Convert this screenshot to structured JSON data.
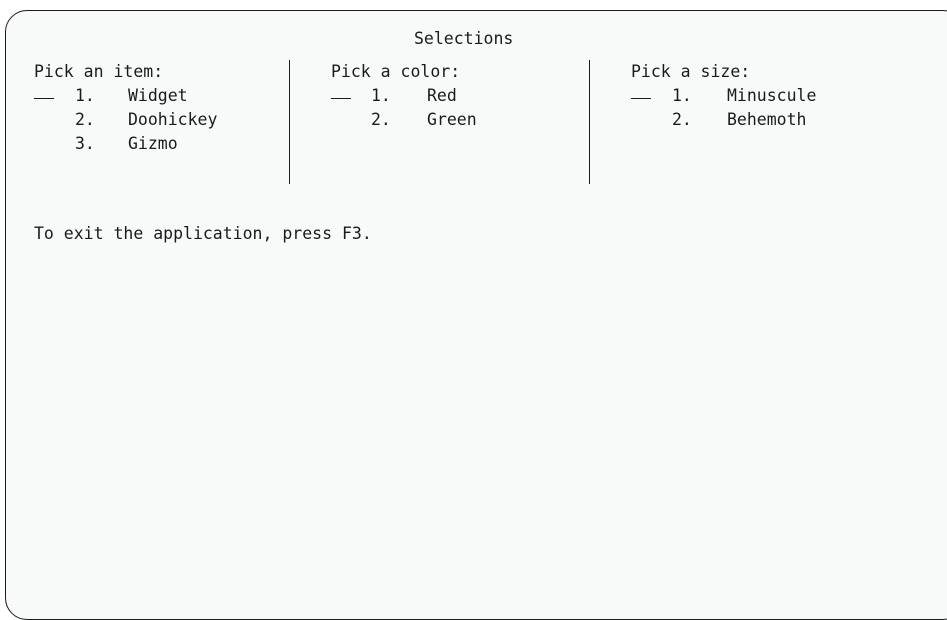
{
  "window": {
    "title": "Selections"
  },
  "columns": [
    {
      "heading": "Pick an item:",
      "input_value": "",
      "options": [
        {
          "num": "1.",
          "label": "Widget"
        },
        {
          "num": "2.",
          "label": "Doohickey"
        },
        {
          "num": "3.",
          "label": "Gizmo"
        }
      ]
    },
    {
      "heading": "Pick a color:",
      "input_value": "",
      "options": [
        {
          "num": "1.",
          "label": "Red"
        },
        {
          "num": "2.",
          "label": "Green"
        }
      ]
    },
    {
      "heading": "Pick a size:",
      "input_value": "",
      "options": [
        {
          "num": "1.",
          "label": "Minuscule"
        },
        {
          "num": "2.",
          "label": "Behemoth"
        }
      ]
    }
  ],
  "footer": {
    "exit_message": "To exit the application, press F3."
  }
}
